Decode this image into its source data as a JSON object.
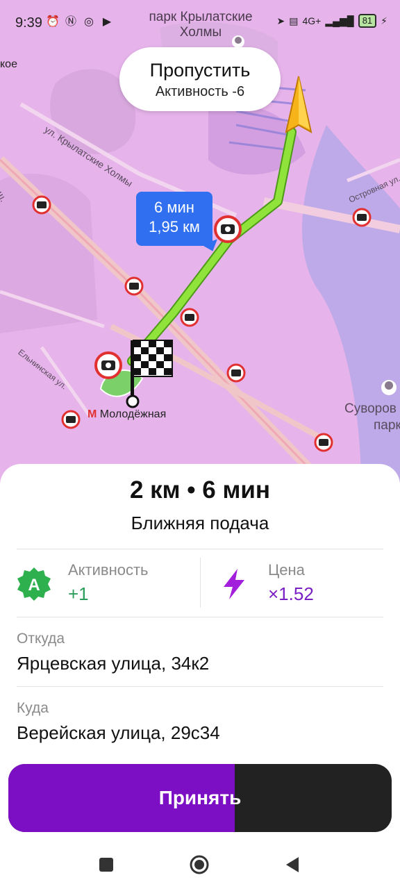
{
  "status_bar": {
    "time": "9:39",
    "battery": "81",
    "network": "4G+"
  },
  "map": {
    "park_title": "парк Крылатские Холмы",
    "street_krylatskie": "ул. Крылатские Холмы",
    "street_elninskaya": "Ельнинская ул.",
    "street_ostrovnaya": "Островная ул.",
    "label_left_top": "кое",
    "label_left_sh": "е ш.",
    "metro_station": "Молодёжная",
    "metro_symbol": "М",
    "suvorov_label": "Суворов",
    "suvorov_label2": "парк",
    "skip_title": "Пропустить",
    "skip_subtitle": "Активность -6",
    "route_time": "6 мин",
    "route_distance": "1,95 км",
    "colors": {
      "map_bg": "#e6b3ea",
      "route": "#7ee02a",
      "route_tip": "#2f6ff0"
    }
  },
  "order": {
    "summary": "2 км • 6 мин",
    "subtitle": "Ближняя подача",
    "activity_label": "Активность",
    "activity_value": "+1",
    "activity_badge": "A",
    "price_label": "Цена",
    "price_value": "×1.52",
    "from_label": "Откуда",
    "from_value": "Ярцевская улица, 34к2",
    "to_label": "Куда",
    "to_value": "Верейская улица, 29с34",
    "accept_label": "Принять",
    "accept_progress": 0.59,
    "colors": {
      "accept_purple": "#7c0fc4",
      "accept_dark": "#222222",
      "activity_green": "#2a9d5b",
      "price_purple": "#7a1fc4"
    }
  },
  "navbar": {
    "icons": [
      "square-recents-icon",
      "circle-home-icon",
      "triangle-back-icon"
    ]
  }
}
